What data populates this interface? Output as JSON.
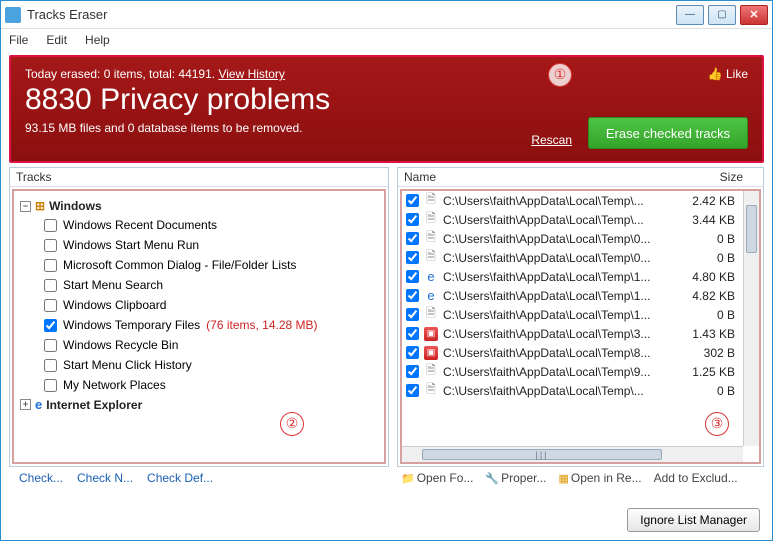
{
  "window": {
    "title": "Tracks Eraser"
  },
  "menu": {
    "file": "File",
    "edit": "Edit",
    "help": "Help"
  },
  "banner": {
    "summary_prefix": "Today erased: 0 items, total: 44191. ",
    "history_link": "View History",
    "headline": "8830 Privacy problems",
    "subline": "93.15 MB files and 0 database items to be removed.",
    "rescan": "Rescan",
    "erase": "Erase checked tracks",
    "like": "Like"
  },
  "left": {
    "header": "Tracks",
    "cat_windows": "Windows",
    "cat_ie": "Internet Explorer",
    "items": [
      {
        "label": "Windows Recent Documents",
        "checked": false
      },
      {
        "label": "Windows Start Menu Run",
        "checked": false
      },
      {
        "label": "Microsoft Common Dialog - File/Folder Lists",
        "checked": false
      },
      {
        "label": "Start Menu Search",
        "checked": false
      },
      {
        "label": "Windows Clipboard",
        "checked": false
      },
      {
        "label": "Windows Temporary Files",
        "checked": true,
        "extra": "(76 items, 14.28 MB)"
      },
      {
        "label": "Windows Recycle Bin",
        "checked": false
      },
      {
        "label": "Start Menu Click History",
        "checked": false
      },
      {
        "label": "My Network Places",
        "checked": false
      }
    ],
    "links": {
      "check": "Check...",
      "checkn": "Check N...",
      "checkdef": "Check Def..."
    }
  },
  "right": {
    "header_name": "Name",
    "header_size": "Size",
    "rows": [
      {
        "icon": "file",
        "path": "C:\\Users\\faith\\AppData\\Local\\Temp\\...",
        "size": "2.42 KB"
      },
      {
        "icon": "file",
        "path": "C:\\Users\\faith\\AppData\\Local\\Temp\\...",
        "size": "3.44 KB"
      },
      {
        "icon": "file",
        "path": "C:\\Users\\faith\\AppData\\Local\\Temp\\0...",
        "size": "0 B"
      },
      {
        "icon": "file",
        "path": "C:\\Users\\faith\\AppData\\Local\\Temp\\0...",
        "size": "0 B"
      },
      {
        "icon": "ie",
        "path": "C:\\Users\\faith\\AppData\\Local\\Temp\\1...",
        "size": "4.80 KB"
      },
      {
        "icon": "ie",
        "path": "C:\\Users\\faith\\AppData\\Local\\Temp\\1...",
        "size": "4.82 KB"
      },
      {
        "icon": "file",
        "path": "C:\\Users\\faith\\AppData\\Local\\Temp\\1...",
        "size": "0 B"
      },
      {
        "icon": "pic",
        "path": "C:\\Users\\faith\\AppData\\Local\\Temp\\3...",
        "size": "1.43 KB"
      },
      {
        "icon": "pic",
        "path": "C:\\Users\\faith\\AppData\\Local\\Temp\\8...",
        "size": "302 B"
      },
      {
        "icon": "file",
        "path": "C:\\Users\\faith\\AppData\\Local\\Temp\\9...",
        "size": "1.25 KB"
      },
      {
        "icon": "file",
        "path": "C:\\Users\\faith\\AppData\\Local\\Temp\\...",
        "size": "0 B"
      }
    ],
    "links": {
      "openfo": "Open Fo...",
      "proper": "Proper...",
      "openinre": "Open in Re...",
      "addexcl": "Add to Exclud..."
    }
  },
  "footer": {
    "ignore": "Ignore List Manager"
  },
  "callouts": {
    "c1": "①",
    "c2": "②",
    "c3": "③"
  }
}
